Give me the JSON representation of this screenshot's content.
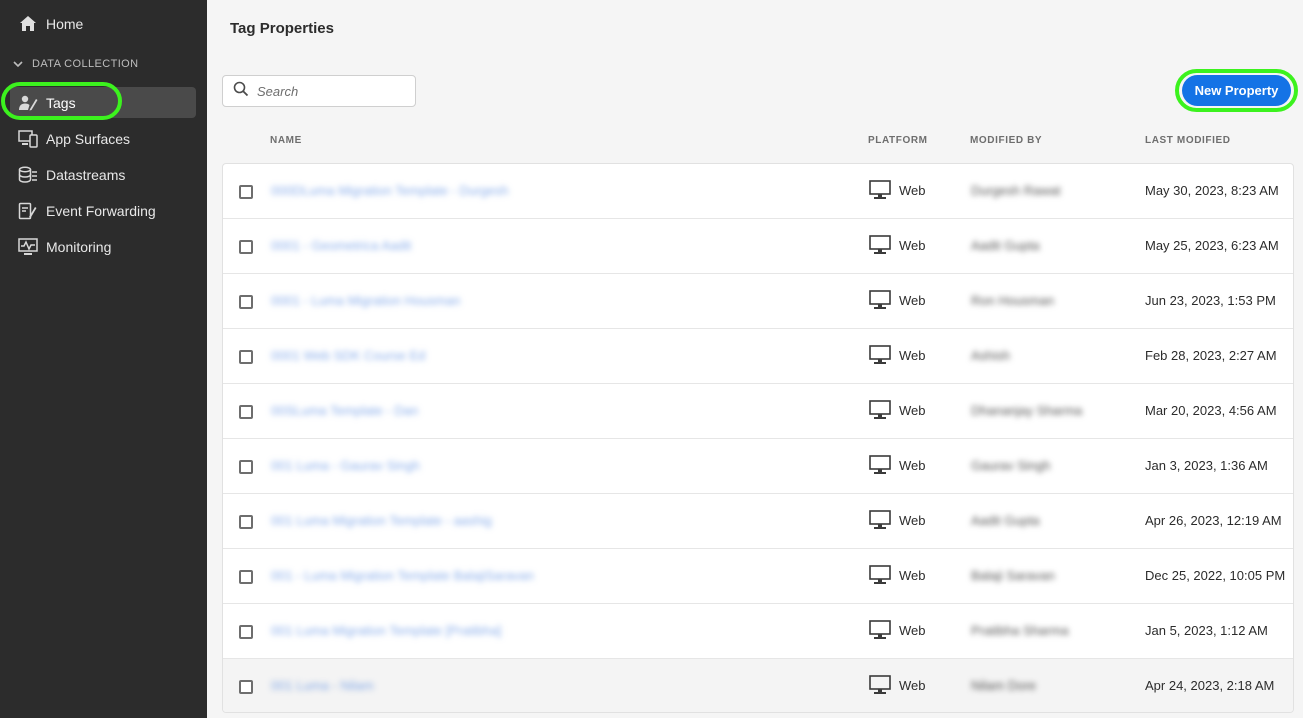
{
  "sidebar": {
    "home": "Home",
    "section": "DATA COLLECTION",
    "items": [
      {
        "label": "Tags",
        "icon": "tags-icon",
        "active": true
      },
      {
        "label": "App Surfaces",
        "icon": "app-surfaces-icon"
      },
      {
        "label": "Datastreams",
        "icon": "datastreams-icon"
      },
      {
        "label": "Event Forwarding",
        "icon": "event-forwarding-icon"
      },
      {
        "label": "Monitoring",
        "icon": "monitoring-icon"
      }
    ]
  },
  "main": {
    "title": "Tag Properties",
    "search_placeholder": "Search",
    "new_button": "New Property",
    "columns": {
      "name": "NAME",
      "platform": "PLATFORM",
      "modified_by": "MODIFIED BY",
      "last_modified": "LAST MODIFIED"
    },
    "rows": [
      {
        "name": "000DLuma Migration Template - Durgesh",
        "platform": "Web",
        "modified_by": "Durgesh Rawat",
        "last_modified": "May 30, 2023, 8:23 AM"
      },
      {
        "name": "0001 - Geometrica Aadit",
        "platform": "Web",
        "modified_by": "Aadit Gupta",
        "last_modified": "May 25, 2023, 6:23 AM"
      },
      {
        "name": "0001 - Luma Migration Housman",
        "platform": "Web",
        "modified_by": "Ron Housman",
        "last_modified": "Jun 23, 2023, 1:53 PM"
      },
      {
        "name": "0001 Web SDK Course Ed",
        "platform": "Web",
        "modified_by": "Ashish",
        "last_modified": "Feb 28, 2023, 2:27 AM"
      },
      {
        "name": "00SLuma Template - Dan",
        "platform": "Web",
        "modified_by": "Dhananjay Sharma",
        "last_modified": "Mar 20, 2023, 4:56 AM"
      },
      {
        "name": "001 Luma - Gaurav Singh",
        "platform": "Web",
        "modified_by": "Gaurav Singh",
        "last_modified": "Jan 3, 2023, 1:36 AM"
      },
      {
        "name": "001 Luma Migration Template - aashig",
        "platform": "Web",
        "modified_by": "Aadit Gupta",
        "last_modified": "Apr 26, 2023, 12:19 AM"
      },
      {
        "name": "001 - Luma Migration Template BalajiSaravan",
        "platform": "Web",
        "modified_by": "Balaji Saravan",
        "last_modified": "Dec 25, 2022, 10:05 PM"
      },
      {
        "name": "001 Luma Migration Template [Pratibha]",
        "platform": "Web",
        "modified_by": "Pratibha Sharma",
        "last_modified": "Jan 5, 2023, 1:12 AM"
      },
      {
        "name": "001 Luma - Nilam",
        "platform": "Web",
        "modified_by": "Nilam Dore",
        "last_modified": "Apr 24, 2023, 2:18 AM"
      }
    ]
  },
  "colors": {
    "sidebar_bg": "#2c2c2c",
    "accent": "#1473e6",
    "highlight": "#3cf21e",
    "link": "#4a82e0"
  }
}
